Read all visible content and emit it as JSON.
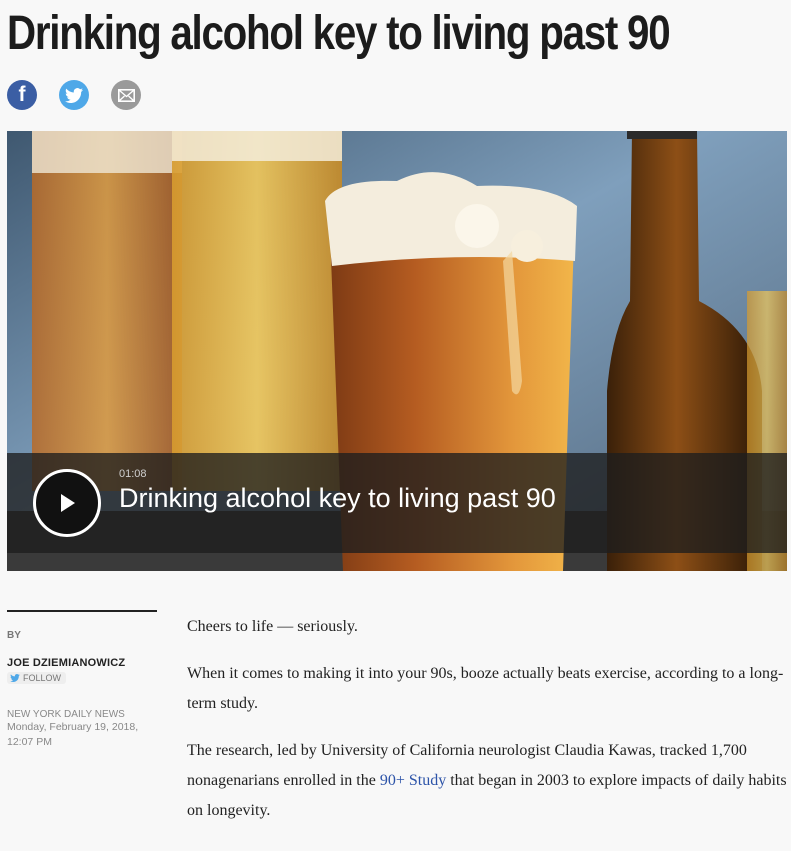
{
  "headline": "Drinking alcohol key to living past 90",
  "share": {
    "facebook_icon": "facebook-icon",
    "twitter_icon": "twitter-icon",
    "email_icon": "email-icon"
  },
  "video": {
    "duration": "01:08",
    "title": "Drinking alcohol key to living past 90"
  },
  "byline": {
    "by_label": "BY",
    "author": "JOE DZIEMIANOWICZ",
    "follow_label": "FOLLOW",
    "source": "NEW YORK DAILY NEWS",
    "date": "Monday, February 19, 2018,",
    "time": "12:07 PM"
  },
  "article": {
    "p1": "Cheers to life — seriously.",
    "p2": "When it comes to making it into your 90s, booze actually beats exercise, according to a long-term study.",
    "p3_before": "The research, led by University of California neurologist Claudia Kawas, tracked 1,700 nonagenarians enrolled in the ",
    "p3_link": "90+ Study",
    "p3_after": " that began in 2003 to explore impacts of daily habits on longevity."
  },
  "colors": {
    "facebook": "#3b5ea4",
    "twitter": "#4fa8e8",
    "link": "#2c53a8"
  }
}
